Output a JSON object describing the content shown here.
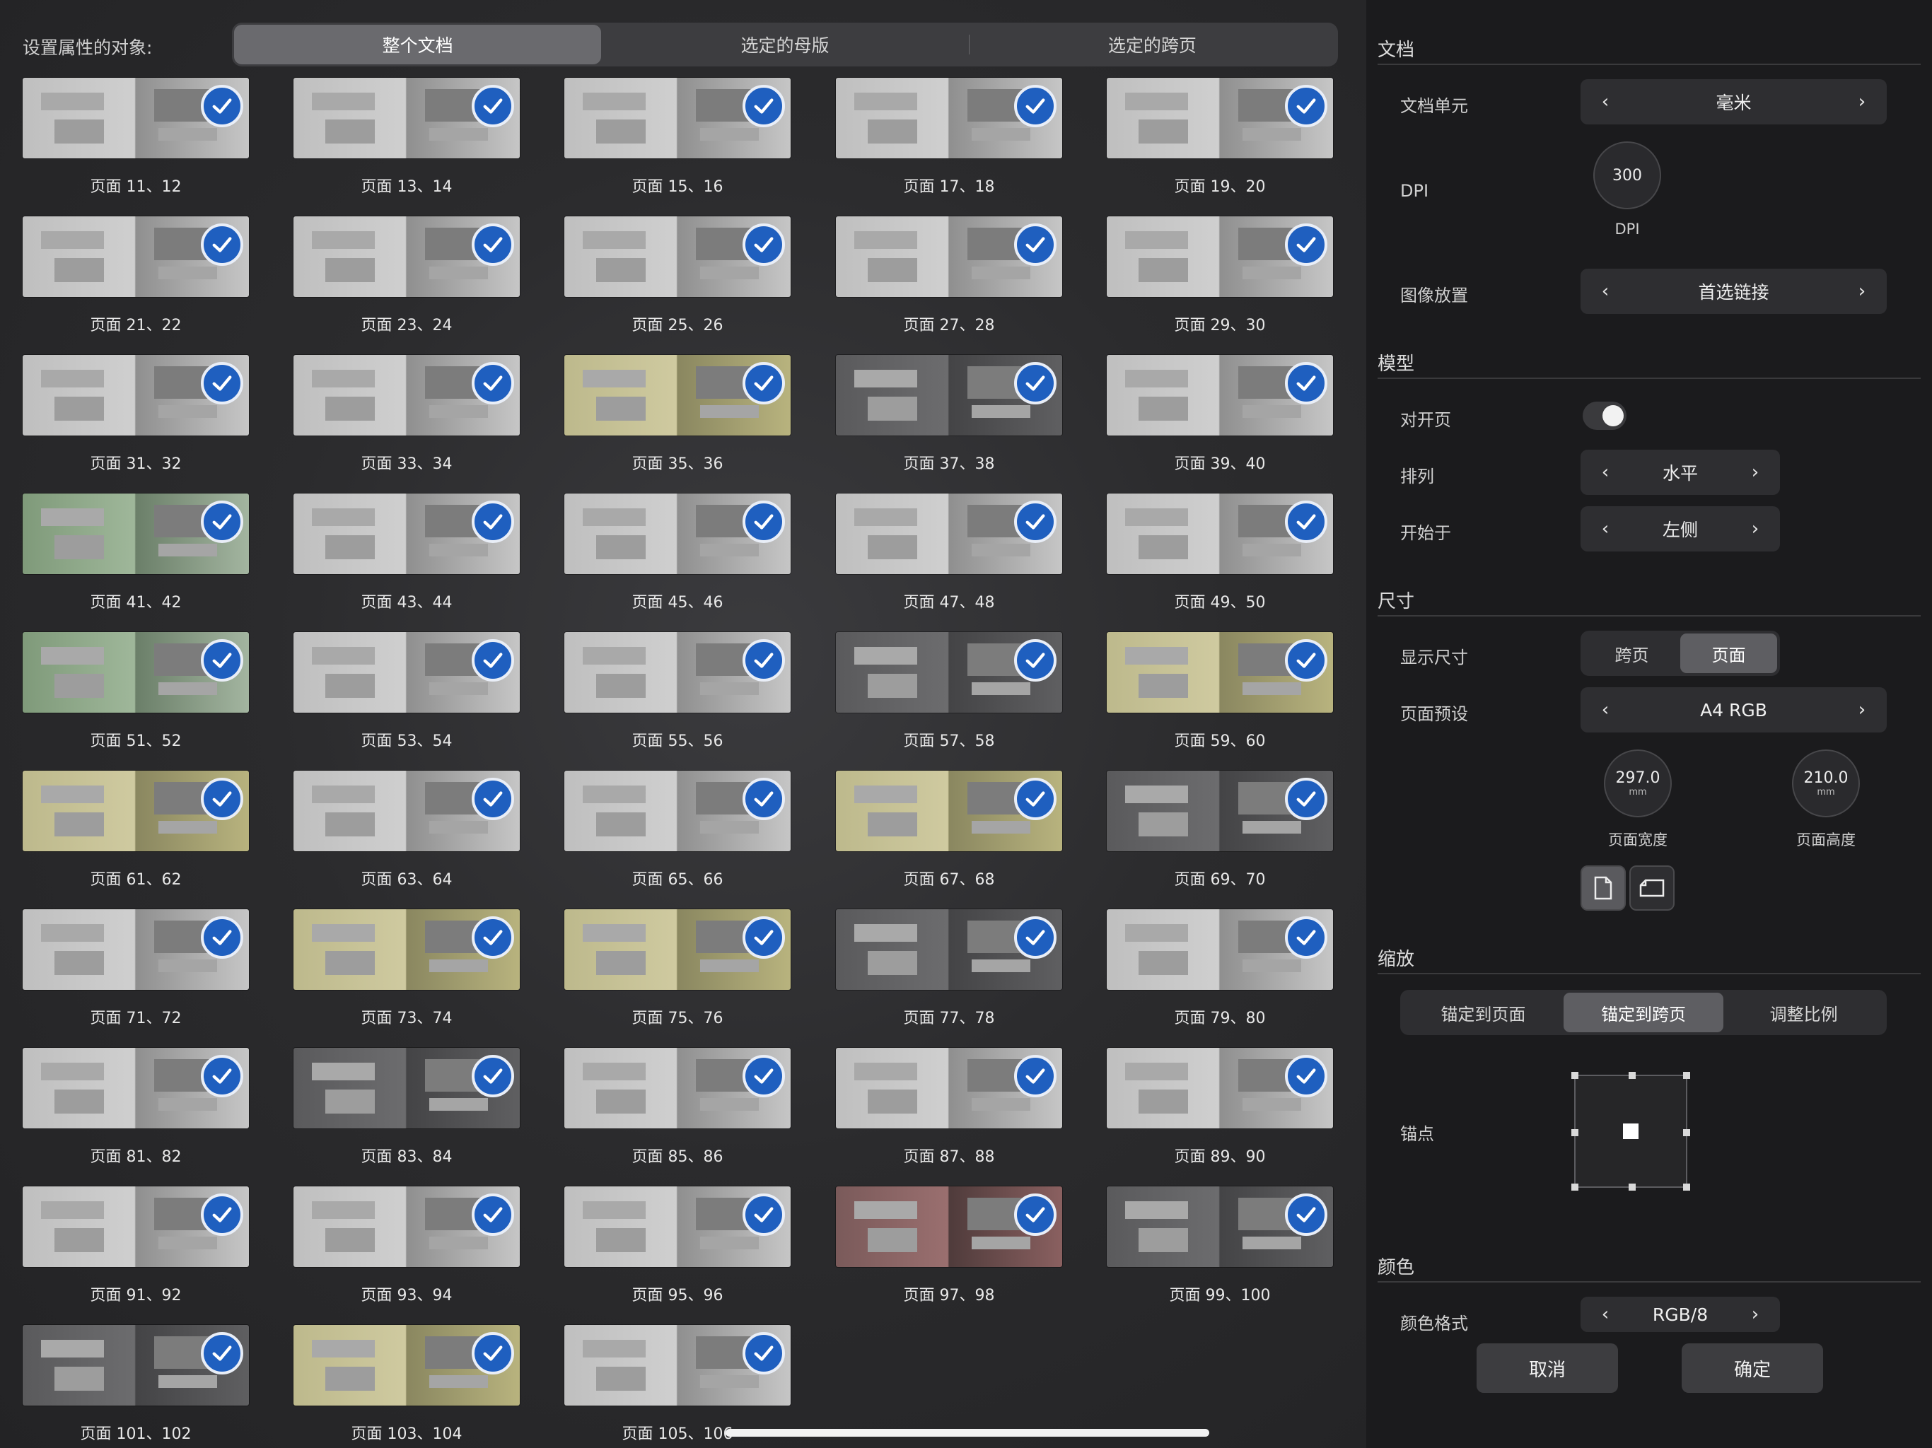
{
  "left": {
    "target_label": "设置属性的对象:",
    "target_tabs": [
      "整个文档",
      "选定的母版",
      "选定的跨页"
    ],
    "active_tab": "整个文档",
    "spreads": [
      {
        "label": "页面 11、12",
        "tone": "light"
      },
      {
        "label": "页面 13、14",
        "tone": "light"
      },
      {
        "label": "页面 15、16",
        "tone": "light"
      },
      {
        "label": "页面 17、18",
        "tone": "light"
      },
      {
        "label": "页面 19、20",
        "tone": "light"
      },
      {
        "label": "页面 21、22",
        "tone": "light"
      },
      {
        "label": "页面 23、24",
        "tone": "light"
      },
      {
        "label": "页面 25、26",
        "tone": "light"
      },
      {
        "label": "页面 27、28",
        "tone": "light"
      },
      {
        "label": "页面 29、30",
        "tone": "light"
      },
      {
        "label": "页面 31、32",
        "tone": "light"
      },
      {
        "label": "页面 33、34",
        "tone": "light"
      },
      {
        "label": "页面 35、36",
        "tone": "yellow"
      },
      {
        "label": "页面 37、38",
        "tone": "dark"
      },
      {
        "label": "页面 39、40",
        "tone": "light"
      },
      {
        "label": "页面 41、42",
        "tone": "green"
      },
      {
        "label": "页面 43、44",
        "tone": "light"
      },
      {
        "label": "页面 45、46",
        "tone": "light"
      },
      {
        "label": "页面 47、48",
        "tone": "light"
      },
      {
        "label": "页面 49、50",
        "tone": "light"
      },
      {
        "label": "页面 51、52",
        "tone": "green"
      },
      {
        "label": "页面 53、54",
        "tone": "light"
      },
      {
        "label": "页面 55、56",
        "tone": "light"
      },
      {
        "label": "页面 57、58",
        "tone": "dark"
      },
      {
        "label": "页面 59、60",
        "tone": "yellow"
      },
      {
        "label": "页面 61、62",
        "tone": "yellow"
      },
      {
        "label": "页面 63、64",
        "tone": "light"
      },
      {
        "label": "页面 65、66",
        "tone": "light"
      },
      {
        "label": "页面 67、68",
        "tone": "yellow"
      },
      {
        "label": "页面 69、70",
        "tone": "dark"
      },
      {
        "label": "页面 71、72",
        "tone": "light"
      },
      {
        "label": "页面 73、74",
        "tone": "yellow"
      },
      {
        "label": "页面 75、76",
        "tone": "yellow"
      },
      {
        "label": "页面 77、78",
        "tone": "dark"
      },
      {
        "label": "页面 79、80",
        "tone": "light"
      },
      {
        "label": "页面 81、82",
        "tone": "light"
      },
      {
        "label": "页面 83、84",
        "tone": "dark"
      },
      {
        "label": "页面 85、86",
        "tone": "light"
      },
      {
        "label": "页面 87、88",
        "tone": "light"
      },
      {
        "label": "页面 89、90",
        "tone": "light"
      },
      {
        "label": "页面 91、92",
        "tone": "light"
      },
      {
        "label": "页面 93、94",
        "tone": "light"
      },
      {
        "label": "页面 95、96",
        "tone": "light"
      },
      {
        "label": "页面 97、98",
        "tone": "red"
      },
      {
        "label": "页面 99、100",
        "tone": "dark"
      },
      {
        "label": "页面 101、102",
        "tone": "dark"
      },
      {
        "label": "页面 103、104",
        "tone": "yellow"
      },
      {
        "label": "页面 105、106",
        "tone": "light"
      }
    ]
  },
  "right": {
    "document": {
      "title": "文档",
      "unit_label": "文档单元",
      "unit_value": "毫米",
      "dpi_label": "DPI",
      "dpi_value": "300",
      "dpi_caption": "DPI",
      "image_placement_label": "图像放置",
      "image_placement_value": "首选链接"
    },
    "model": {
      "title": "模型",
      "facing_pages_label": "对开页",
      "arrange_label": "排列",
      "arrange_value": "水平",
      "start_label": "开始于",
      "start_value": "左侧"
    },
    "size": {
      "title": "尺寸",
      "display_size_label": "显示尺寸",
      "display_options": [
        "跨页",
        "页面"
      ],
      "display_active": "页面",
      "preset_label": "页面预设",
      "preset_value": "A4 RGB",
      "width_value": "297.0",
      "width_unit": "mm",
      "width_caption": "页面宽度",
      "height_value": "210.0",
      "height_unit": "mm",
      "height_caption": "页面高度"
    },
    "scale": {
      "title": "缩放",
      "options": [
        "锚定到页面",
        "锚定到跨页",
        "调整比例"
      ],
      "active": "锚定到跨页",
      "anchor_label": "锚点"
    },
    "color": {
      "title": "颜色",
      "format_label": "颜色格式",
      "format_value": "RGB/8"
    },
    "buttons": {
      "cancel": "取消",
      "ok": "确定"
    }
  },
  "colors": {
    "accent_check": "#1f5fbf",
    "active_segment": "#6a6a6e",
    "panel_bg": "#1b1b1d"
  }
}
